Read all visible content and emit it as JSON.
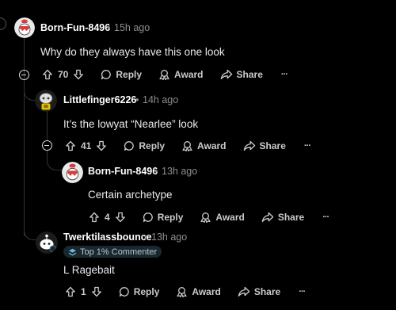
{
  "comments": [
    {
      "author": "Born-Fun-8496",
      "sep": "•",
      "time": "15h ago",
      "text": "Why do they always have this one look",
      "votes": "70",
      "reply": "Reply",
      "award": "Award",
      "share": "Share",
      "more": "···"
    },
    {
      "author": "Littlefinger6226",
      "sep": "•",
      "time": "14h ago",
      "text": "It’s the lowyat “Nearlee” look",
      "votes": "41",
      "reply": "Reply",
      "award": "Award",
      "share": "Share",
      "more": "···"
    },
    {
      "author": "Born-Fun-8496",
      "sep": "•",
      "time": "13h ago",
      "text": "Certain archetype",
      "votes": "4",
      "reply": "Reply",
      "award": "Award",
      "share": "Share",
      "more": "···"
    },
    {
      "author": "Twerktilassbounce",
      "sep": "•",
      "time": "13h ago",
      "badge": "Top 1% Commenter",
      "text": "L Ragebait",
      "votes": "1",
      "reply": "Reply",
      "award": "Award",
      "share": "Share",
      "more": "···"
    }
  ],
  "colors": {
    "background": "#000000",
    "thread_line": "#343536",
    "meta_text": "#8b8e90",
    "badge_bg": "#1a282d"
  }
}
